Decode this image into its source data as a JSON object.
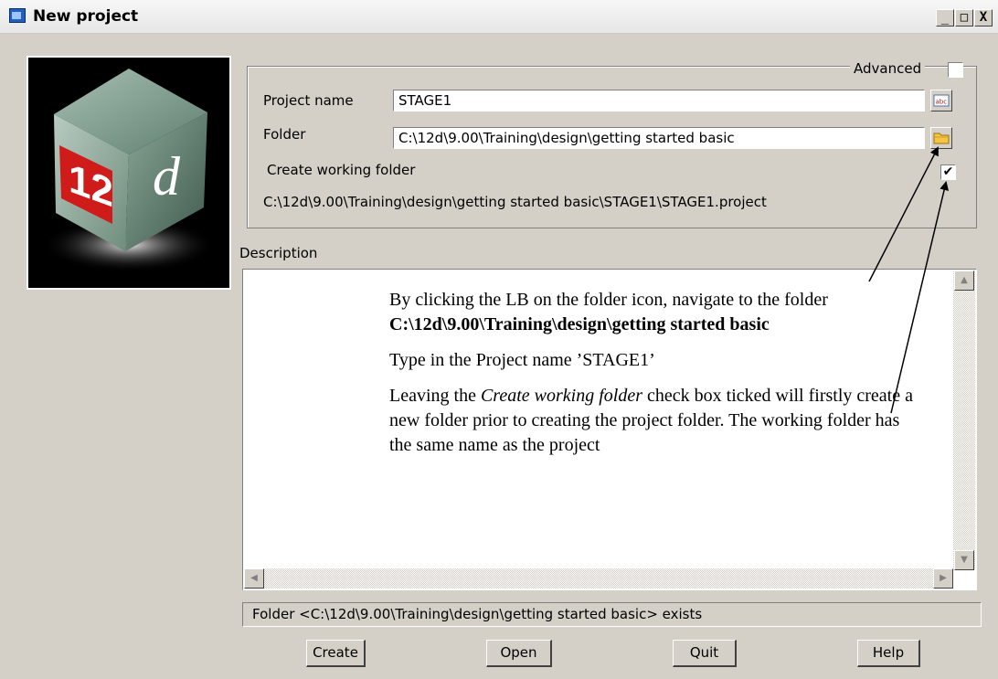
{
  "window": {
    "title": "New project",
    "minimize_glyph": "_",
    "maximize_glyph": "□",
    "close_glyph": "X"
  },
  "logo": {
    "text_a": "12",
    "text_b": "d"
  },
  "advanced": {
    "label": "Advanced",
    "checked": false
  },
  "project": {
    "name_label": "Project name",
    "name_value": "STAGE1",
    "folder_label": "Folder",
    "folder_value": "C:\\12d\\9.00\\Training\\design\\getting started basic",
    "create_working_label": "Create working folder",
    "create_working_checked": true,
    "create_working_mark": "✔",
    "project_path": "C:\\12d\\9.00\\Training\\design\\getting started basic\\STAGE1\\STAGE1.project"
  },
  "description": {
    "label": "Description",
    "para1_prefix": "By clicking the LB on the folder icon, navigate to the folder ",
    "para1_bold": "C:\\12d\\9.00\\Training\\design\\getting started basic",
    "para2": "Type in the Project name ’STAGE1’",
    "para3_prefix": "Leaving the ",
    "para3_italic": "Create working folder",
    "para3_suffix": " check box ticked will firstly create a new folder prior to creating the project folder. The working folder has the same name as the project"
  },
  "status": {
    "text": "Folder <C:\\12d\\9.00\\Training\\design\\getting started basic> exists"
  },
  "buttons": {
    "create": "Create",
    "open": "Open",
    "quit": "Quit",
    "help": "Help"
  },
  "icons": {
    "name_picker": "abc-text-icon",
    "folder_picker": "folder-icon",
    "app": "window-app-icon"
  },
  "colors": {
    "folder_icon": "#f5c542",
    "logo_cube": "#6e8c7c",
    "logo_face": "#cc1d1d"
  }
}
